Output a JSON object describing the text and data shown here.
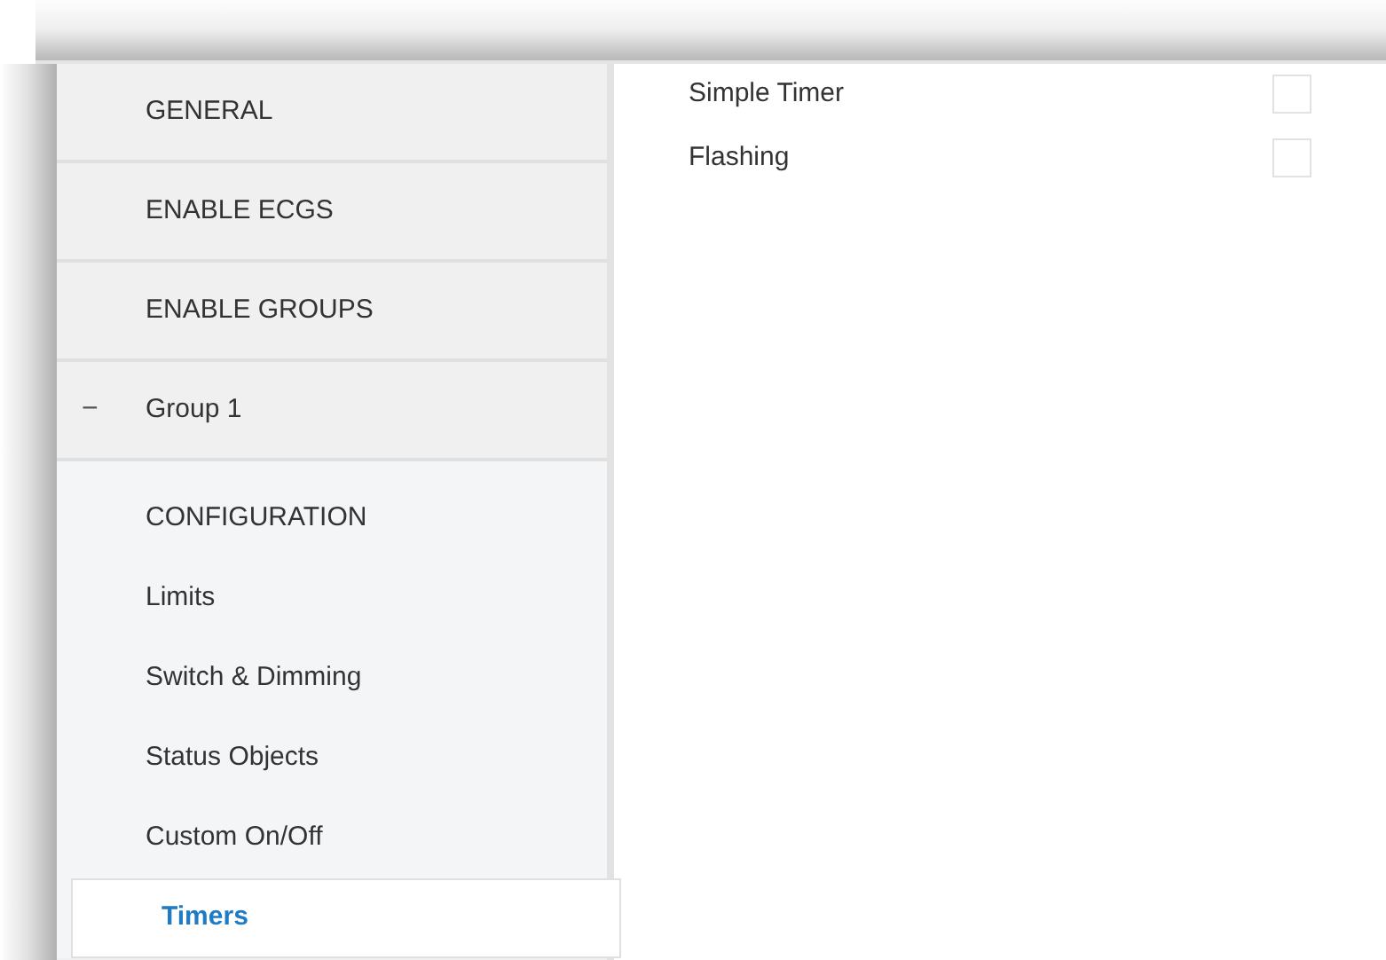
{
  "sidebar": {
    "items": [
      {
        "label": "GENERAL",
        "selected": false
      },
      {
        "label": "ENABLE ECGS",
        "selected": false
      },
      {
        "label": "ENABLE GROUPS",
        "selected": false
      },
      {
        "label": "Group 1",
        "selected": false,
        "expanded": true,
        "toggle": "−",
        "children": [
          {
            "label": "CONFIGURATION",
            "selected": false
          },
          {
            "label": "Limits",
            "selected": false
          },
          {
            "label": "Switch & Dimming",
            "selected": false
          },
          {
            "label": "Status Objects",
            "selected": false
          },
          {
            "label": "Custom On/Off",
            "selected": false
          },
          {
            "label": "Timers",
            "selected": true
          }
        ]
      }
    ]
  },
  "options": [
    {
      "label": "Simple Timer",
      "checked": false
    },
    {
      "label": "Flashing",
      "checked": false
    }
  ]
}
